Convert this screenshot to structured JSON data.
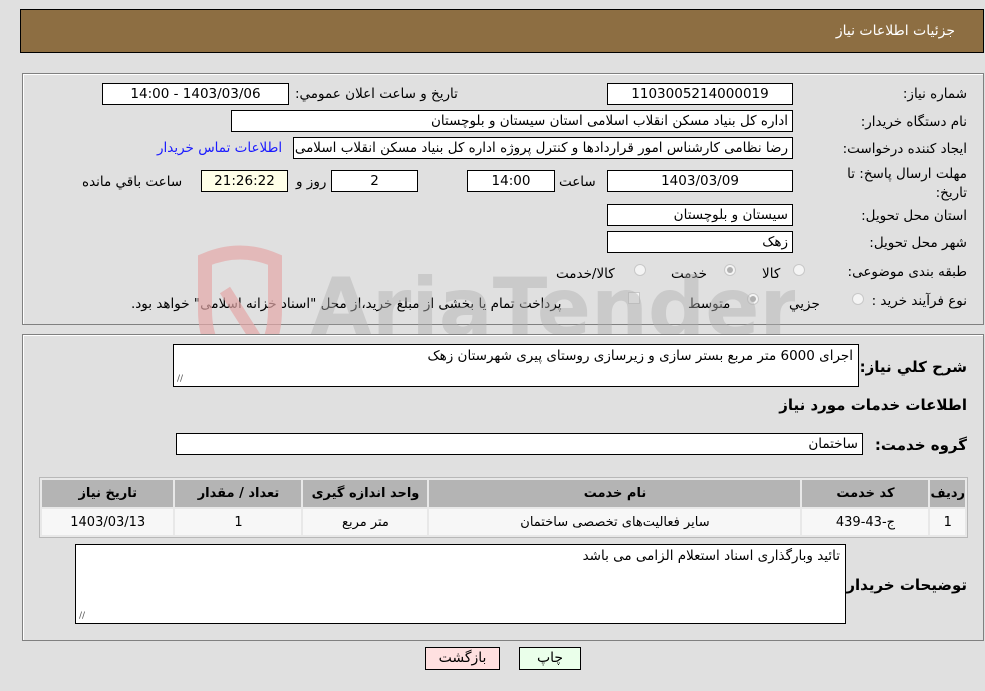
{
  "header": {
    "title": "جزئیات اطلاعات نیاز"
  },
  "form": {
    "need_number": {
      "label": "شماره نیاز:",
      "value": "1103005214000019"
    },
    "announce": {
      "label": "تاریخ و ساعت اعلان عمومي:",
      "value": "1403/03/06 - 14:00"
    },
    "buyer_org": {
      "label": "نام دستگاه خریدار:",
      "value": "اداره کل بنیاد مسکن انقلاب اسلامی استان سیستان و بلوچستان"
    },
    "requester": {
      "label": "ایجاد کننده درخواست:",
      "value": "رضا نظامی کارشناس امور قراردادها و کنترل پروژه اداره کل بنیاد مسکن انقلاب اسلامی",
      "contact_link": "اطلاعات تماس خریدار"
    },
    "deadline": {
      "label": "مهلت ارسال پاسخ: تا تاریخ:",
      "date": "1403/03/09",
      "time_label": "ساعت",
      "time": "14:00",
      "days": "2",
      "days_label": "روز و",
      "remaining": "21:26:22",
      "remaining_label": "ساعت باقي مانده"
    },
    "province": {
      "label": "استان محل تحویل:",
      "value": "سیستان و بلوچستان"
    },
    "city": {
      "label": "شهر محل تحویل:",
      "value": "زهک"
    },
    "category": {
      "label": "طبقه بندی موضوعی:",
      "options": [
        {
          "label": "کالا",
          "checked": false
        },
        {
          "label": "خدمت",
          "checked": true
        },
        {
          "label": "کالا/خدمت",
          "checked": false
        }
      ]
    },
    "purchase_type": {
      "label": "نوع فرآیند خرید :",
      "options": [
        {
          "label": "جزيي",
          "checked": false
        },
        {
          "label": "متوسط",
          "checked": true
        }
      ],
      "treasury_note": "پرداخت تمام یا بخشی از مبلغ خرید،از محل \"اسناد خزانه اسلامی\" خواهد بود."
    }
  },
  "details": {
    "description_label": "شرح كلي نياز:",
    "description": "اجرای 6000 متر مربع بستر سازی و زیرسازی روستای پیری شهرستان زهک",
    "services_title": "اطلاعات خدمات مورد نیاز",
    "service_group_label": "گروه خدمت:",
    "service_group": "ساختمان",
    "table": {
      "headers": [
        "ردیف",
        "کد خدمت",
        "نام خدمت",
        "واحد اندازه گیری",
        "تعداد / مقدار",
        "تاریخ نیاز"
      ],
      "rows": [
        [
          "1",
          "ج-43-439",
          "سایر فعالیت‌های تخصصی ساختمان",
          "متر مربع",
          "1",
          "1403/03/13"
        ]
      ]
    },
    "buyer_notes_label": "توضیحات خریدار:",
    "buyer_notes": "تائید وبارگذاری اسناد استعلام الزامی می باشد"
  },
  "buttons": {
    "print": "چاپ",
    "back": "بازگشت"
  },
  "colors": {
    "header": "#8d6e42",
    "print_button": "#eaffea",
    "back_button": "#ffe0e0",
    "link": "#1a1aff"
  }
}
